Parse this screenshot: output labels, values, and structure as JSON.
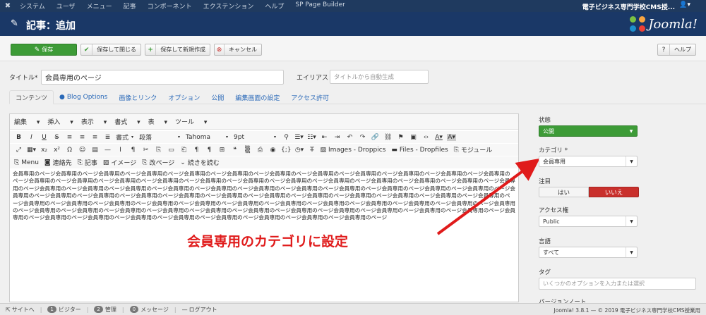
{
  "topnav": {
    "menu": [
      "システム",
      "ユーザ",
      "メニュー",
      "記事",
      "コンポーネント",
      "エクステンション",
      "ヘルプ",
      "SP Page Builder"
    ],
    "site": "電子ビジネス専門学校CMS授...",
    "user_icon": "user-icon"
  },
  "header": {
    "title": "記事：追加",
    "logo_text": "Joomla!"
  },
  "toolbar": {
    "save": "保存",
    "save_close": "保存して閉じる",
    "save_new": "保存して新規作成",
    "cancel": "キャンセル",
    "help": "ヘルプ"
  },
  "form": {
    "title_label": "タイトル",
    "required_mark": "*",
    "title_value": "会員専用のページ",
    "alias_label": "エイリアス",
    "alias_placeholder": "タイトルから自動生成"
  },
  "tabs": [
    "コンテンツ",
    "Blog Options",
    "画像とリンク",
    "オプション",
    "公開",
    "編集画面の設定",
    "アクセス許可"
  ],
  "editor": {
    "menubar": [
      "編集",
      "挿入",
      "表示",
      "書式",
      "表",
      "ツール"
    ],
    "row1": {
      "format": "書式",
      "paragraph": "段落",
      "font": "Tahoma",
      "size": "9pt"
    },
    "row2": {
      "images": "Images - Droppics",
      "files": "Files - Dropfiles",
      "module": "モジュール"
    },
    "row3": {
      "menu": "Menu",
      "contact": "連絡先",
      "article": "記事",
      "image": "イメージ",
      "pagebreak": "改ページ",
      "readmore": "続きを読む"
    },
    "content": "会員専用のページ会員専用のページ会員専用のページ会員専用のページ会員専用のページ会員専用のページ会員専用のページ会員専用のページ会員専用のページ会員専用のページ会員専用のページ会員専用のページ会員専用のページ会員専用のページ会員専用のページ会員専用のページ会員専用のページ会員専用のページ会員専用のページ会員専用のページ会員専用のページ会員専用のページ会員専用のページ会員専用のページ会員専用のページ会員専用のページ会員専用のページ会員専用のページ会員専用のページ会員専用のページ会員専用のページ会員専用のページ会員専用のページ会員専用のページ会員専用のページ会員専用のページ会員専用のページ会員専用のページ会員専用のページ会員専用のページ会員専用のページ会員専用のページ会員専用のページ会員専用のページ会員専用のページ会員専用のページ会員専用のページ会員専用のページ会員専用のページ会員専用のページ会員専用のページ会員専用のページ会員専用のページ会員専用のページ会員専用のページ会員専用のページ会員専用のページ会員専用のページ会員専用のページ会員専用のページ会員専用のページ会員専用のページ会員専用のページ会員専用のページ会員専用のページ会員専用のページ会員専用のページ会員専用のページ会員専用のページ会員専用のページ会員専用のページ会員専用のページ会員専用のページ会員専用のページ会員専用のページ会員専用のページ会員専用のページ会員専用のページ会員専用のページ"
  },
  "annotation": {
    "text": "会員専用のカテゴリに設定",
    "color": "#e01b1b"
  },
  "sidebar": {
    "status_label": "状態",
    "status_value": "公開",
    "category_label": "カテゴリ",
    "category_value": "会員専用",
    "featured_label": "注目",
    "featured_yes": "はい",
    "featured_no": "いいえ",
    "access_label": "アクセス権",
    "access_value": "Public",
    "language_label": "言語",
    "language_value": "すべて",
    "tags_label": "タグ",
    "tags_placeholder": "いくつかのオプションを入力または選択",
    "version_label": "バージョンノート"
  },
  "footer": {
    "site": "サイトへ",
    "visitors_count": "1",
    "visitors": "ビジター",
    "admins_count": "2",
    "admins": "管理",
    "messages_count": "0",
    "messages": "メッセージ",
    "logout": "ログアウト",
    "copyright": "Joomla! 3.8.1 — © 2019 電子ビジネス専門学校CMS授業用"
  },
  "colors": {
    "nav": "#1f3a5f",
    "header": "#1a3867",
    "success": "#3d9b37",
    "danger": "#c9302c",
    "link": "#2a69b8"
  }
}
